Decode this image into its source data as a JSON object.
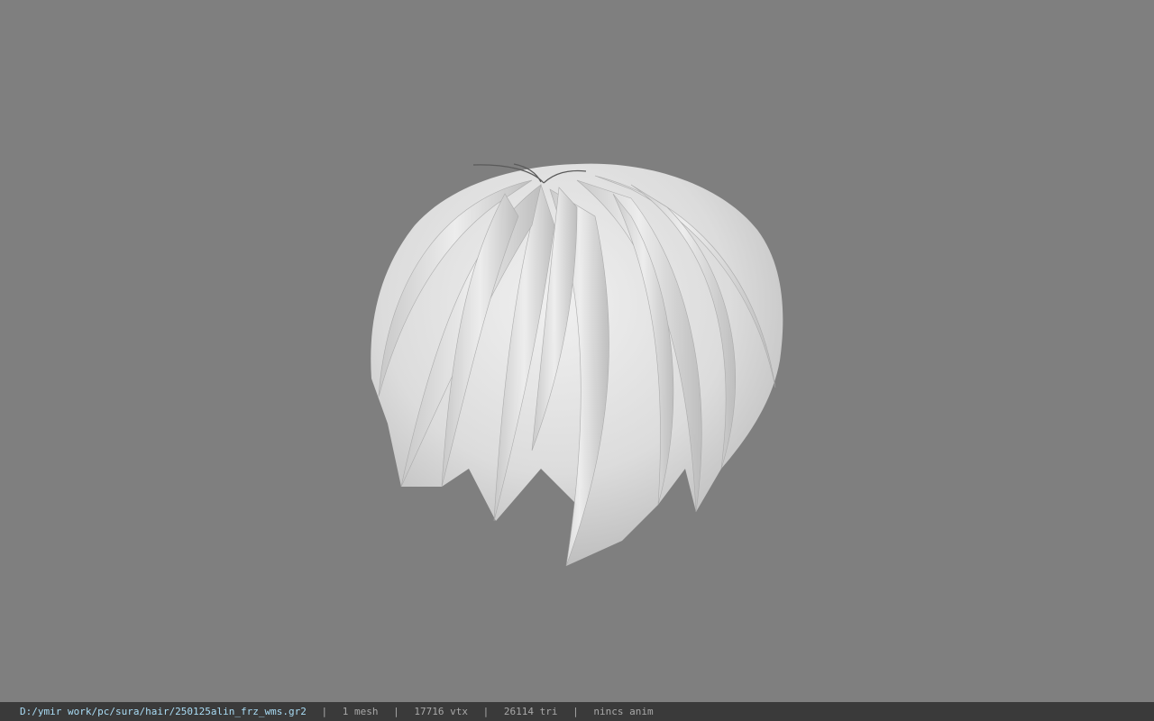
{
  "viewer": {
    "background_color": "#7f7f7f",
    "model_color": "#e6e6e6",
    "model_name": "hair mesh"
  },
  "status": {
    "file_path": "D:/ymir work/pc/sura/hair/250125alin_frz_wms.gr2",
    "separator": "|",
    "mesh_count": "1 mesh",
    "vertex_count": "17716 vtx",
    "tri_count": "26114 tri",
    "anim_status": "nincs anim",
    "path_color": "#a9dcf5",
    "text_color": "#a8a8a8",
    "bar_color": "#3a3a3a"
  }
}
